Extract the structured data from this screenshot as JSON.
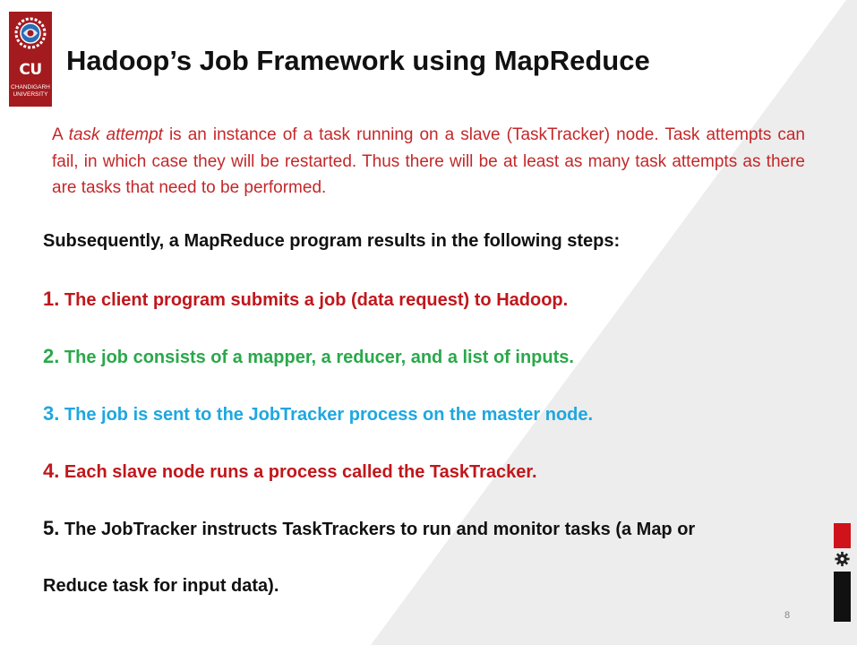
{
  "slide": {
    "title": "Hadoop’s Job Framework using MapReduce",
    "logo": {
      "mark": "CU",
      "name_line1": "CHANDIGARH",
      "name_line2": "UNIVERSITY"
    },
    "intro": {
      "lead": "A ",
      "emphasis": "task attempt",
      "rest": " is an instance of a task running on a slave (TaskTracker) node. Task attempts can fail, in which case they will be restarted. Thus there will be at least as many task attempts as there are tasks that need to be performed."
    },
    "subheading": "Subsequently, a MapReduce program results in the following steps:",
    "steps": [
      {
        "number": "1.",
        "text": "The client program submits a job (data request) to Hadoop.",
        "color": "#c0171c"
      },
      {
        "number": "2.",
        "text": "The job consists of a mapper, a reducer, and a list of inputs.",
        "color": "#2aa84a"
      },
      {
        "number": "3.",
        "text": "The job is sent to the JobTracker process on the master node.",
        "color": "#1ea7e0"
      },
      {
        "number": "4.",
        "text": "Each slave node runs a process called the TaskTracker.",
        "color": "#c0171c"
      },
      {
        "number": "5.",
        "text": "The JobTracker instructs TaskTrackers to run and monitor tasks (a Map or",
        "color": "#111111"
      }
    ],
    "step5_continuation": "Reduce task for input data).",
    "page_number": "8",
    "icons": [
      "university-logo-emblem",
      "gear-icon"
    ]
  }
}
